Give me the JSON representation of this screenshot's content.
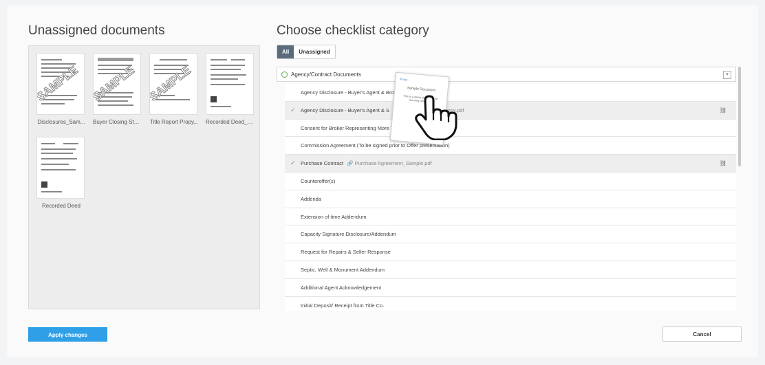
{
  "left_panel": {
    "title": "Unassigned documents",
    "documents": [
      {
        "label": "Disclosures_Sam...",
        "watermark": "SAMPLE"
      },
      {
        "label": "Buyer Closing Stat...",
        "watermark": "SAMPLE"
      },
      {
        "label": "Title Report Propy...",
        "watermark": "SAMPLE"
      },
      {
        "label": "Recorded Deed_S...",
        "watermark": ""
      },
      {
        "label": "Recorded Deed",
        "watermark": ""
      }
    ]
  },
  "right_panel": {
    "title": "Choose checklist category",
    "tabs": [
      {
        "label": "All",
        "active": true
      },
      {
        "label": "Unassigned",
        "active": false
      }
    ],
    "category": {
      "label": "Agency/Contract Documents",
      "collapse_icon": "collapse-icon"
    },
    "rows": [
      {
        "label": "Agency Disclosure - Buyer's Agent & Broker",
        "done": false,
        "attachment": ""
      },
      {
        "label": "Agency Disclosure - Buyer's Agent & S",
        "done": true,
        "attachment": "Purchase Agreement Propy.pdf"
      },
      {
        "label": "Consent for Broker Representing More Than One Party",
        "done": false,
        "attachment": ""
      },
      {
        "label": "Commission Agreement (To be signed prior to Offer presentation)",
        "done": false,
        "attachment": ""
      },
      {
        "label": "Purchase Contract",
        "done": true,
        "attachment": "Purchase Agreement_Sample.pdf"
      },
      {
        "label": "Counteroffer(s)",
        "done": false,
        "attachment": ""
      },
      {
        "label": "Addenda",
        "done": false,
        "attachment": ""
      },
      {
        "label": "Extension of time Addendum",
        "done": false,
        "attachment": ""
      },
      {
        "label": "Capacity Signature Disclosure/Addendum",
        "done": false,
        "attachment": ""
      },
      {
        "label": "Request for Repairs & Seller Response",
        "done": false,
        "attachment": ""
      },
      {
        "label": "Septic, Well & Monument Addendum",
        "done": false,
        "attachment": ""
      },
      {
        "label": "Additional Agent Acknowledgement",
        "done": false,
        "attachment": ""
      },
      {
        "label": "Initial Deposit/ Receipt from Title Co.",
        "done": false,
        "attachment": ""
      }
    ]
  },
  "drag_card": {
    "logo": "Propy",
    "title": "Sample Document",
    "message": "This is a demo document for learning purposes"
  },
  "footer": {
    "apply_label": "Apply changes",
    "cancel_label": "Cancel"
  },
  "colors": {
    "primary_button": "#2f9fe8",
    "check_green": "#6aa84f",
    "active_tab": "#5a6b7b"
  }
}
